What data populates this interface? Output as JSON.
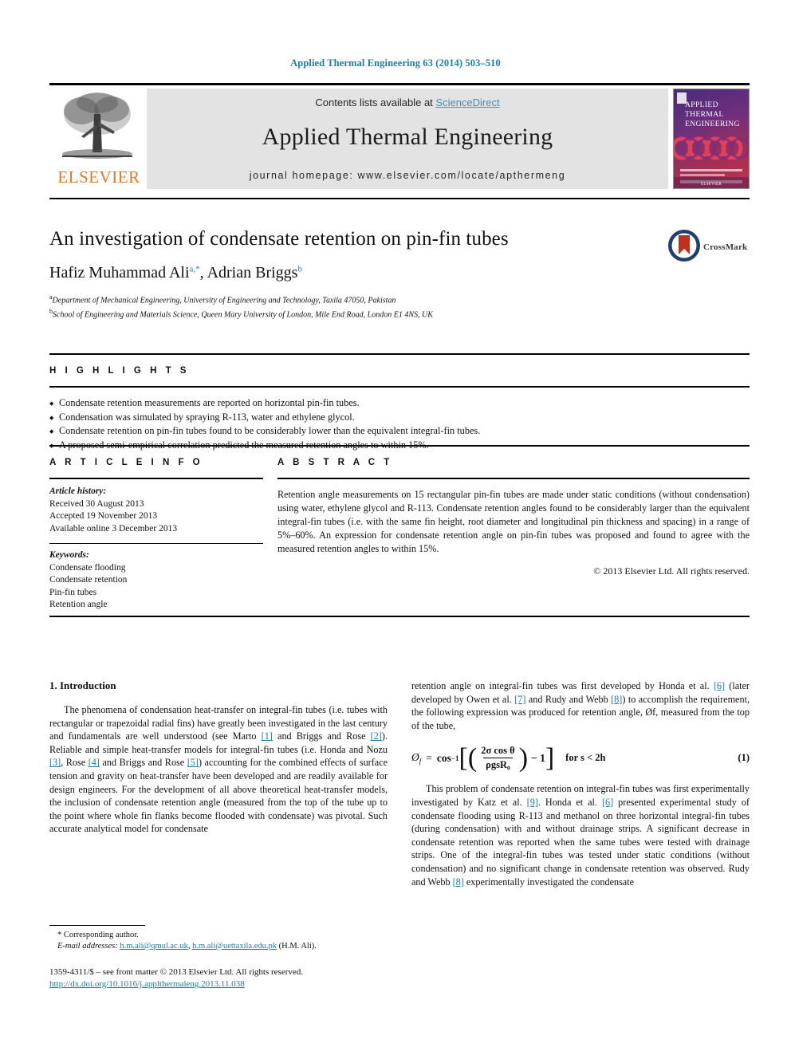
{
  "running_head": "Applied Thermal Engineering 63 (2014) 503–510",
  "masthead": {
    "contents_prefix": "Contents lists available at ",
    "sciencedirect": "ScienceDirect",
    "journal_name": "Applied Thermal Engineering",
    "homepage": "journal homepage: www.elsevier.com/locate/apthermeng",
    "publisher": "ELSEVIER",
    "publisher_logo": "elsevier-tree-logo",
    "cover": {
      "line1": "APPLIED",
      "line2": "THERMAL",
      "line3": "ENGINEERING",
      "footer": "ELSEVIER"
    },
    "accent_blue": "#3d8fc6",
    "band_gray": "#e3e3e3",
    "elsevier_orange": "#e87722"
  },
  "article": {
    "title": "An investigation of condensate retention on pin-fin tubes",
    "authors_html": "Hafiz Muhammad Ali, Adrian Briggs",
    "author1": "Hafiz Muhammad Ali",
    "author1_sup": "a,*",
    "author2": "Adrian Briggs",
    "author2_sup": "b",
    "affiliations": [
      {
        "marker": "a",
        "text": "Department of Mechanical Engineering, University of Engineering and Technology, Taxila 47050, Pakistan"
      },
      {
        "marker": "b",
        "text": "School of Engineering and Materials Science, Queen Mary University of London, Mile End Road, London E1 4NS, UK"
      }
    ],
    "crossmark_label": "CrossMark"
  },
  "highlights": {
    "heading": "H I G H L I G H T S",
    "items": [
      "Condensate retention measurements are reported on horizontal pin-fin tubes.",
      "Condensation was simulated by spraying R-113, water and ethylene glycol.",
      "Condensate retention on pin-fin tubes found to be considerably lower than the equivalent integral-fin tubes.",
      "A proposed semi-empirical correlation predicted the measured retention angles to within 15%."
    ]
  },
  "article_info": {
    "heading": "A R T I C L E    I N F O",
    "history_label": "Article history:",
    "history": [
      "Received 30 August 2013",
      "Accepted 19 November 2013",
      "Available online 3 December 2013"
    ],
    "keywords_label": "Keywords:",
    "keywords": [
      "Condensate flooding",
      "Condensate retention",
      "Pin-fin tubes",
      "Retention angle"
    ]
  },
  "abstract": {
    "heading": "A B S T R A C T",
    "text": "Retention angle measurements on 15 rectangular pin-fin tubes are made under static conditions (without condensation) using water, ethylene glycol and R-113. Condensate retention angles found to be considerably larger than the equivalent integral-fin tubes (i.e. with the same fin height, root diameter and longitudinal pin thickness and spacing) in a range of 5%–60%. An expression for condensate retention angle on pin-fin tubes was proposed and found to agree with the measured retention angles to within 15%.",
    "copyright": "© 2013 Elsevier Ltd. All rights reserved."
  },
  "introduction": {
    "heading": "1.  Introduction",
    "left_paragraph_parts": [
      "The phenomena of condensation heat-transfer on integral-fin tubes (i.e. tubes with rectangular or trapezoidal radial fins) have greatly been investigated in the last century and fundamentals are well understood (see Marto ",
      "[1]",
      " and Briggs and Rose ",
      "[2]",
      "). Reliable and simple heat-transfer models for integral-fin tubes (i.e. Honda and Nozu ",
      "[3]",
      ", Rose ",
      "[4]",
      " and Briggs and Rose ",
      "[5]",
      ") accounting for the combined effects of surface tension and gravity on heat-transfer have been developed and are readily available for design engineers. For the development of all above theoretical heat-transfer models, the inclusion of condensate retention angle (measured from the top of the tube up to the point where whole fin flanks become flooded with condensate) was pivotal. Such accurate analytical model for condensate"
    ],
    "right_paragraph1_parts": [
      "retention angle on integral-fin tubes was first developed by Honda et al. ",
      "[6]",
      " (later developed by Owen et al. ",
      "[7]",
      " and Rudy and Webb ",
      "[8]",
      ") to accomplish the requirement, the following expression was produced for retention angle, Øf, measured from the top of the tube,"
    ],
    "right_paragraph2_parts": [
      "This problem of condensate retention on integral-fin tubes was first experimentally investigated by Katz et al. ",
      "[9]",
      ". Honda et al. ",
      "[6]",
      " presented experimental study of condensate flooding using R-113 and methanol on three horizontal integral-fin tubes (during condensation) with and without drainage strips. A significant decrease in condensate retention was reported when the same tubes were tested with drainage strips. One of the integral-fin tubes was tested under static conditions (without condensation) and no significant change in condensate retention was observed. Rudy and Webb ",
      "[8]",
      " experimentally investigated the condensate"
    ]
  },
  "equation": {
    "lhs": "Ø",
    "lhs_sub": "f",
    "equals": "=",
    "func": "cos",
    "exp": "−1",
    "numerator": "2σ cos θ",
    "denominator": "ρgsR₀",
    "minus_one": "− 1",
    "condition": "for  s < 2h",
    "number": "(1)"
  },
  "footnotes": {
    "corresponding": "* Corresponding author.",
    "email_label": "E-mail addresses:",
    "email1": "h.m.ali@qmul.ac.uk",
    "email2": "h.m.ali@uettaxila.edu.pk",
    "email_suffix": "(H.M. Ali)."
  },
  "page_footer": {
    "issn_line": "1359-4311/$ – see front matter © 2013 Elsevier Ltd. All rights reserved.",
    "doi": "http://dx.doi.org/10.1016/j.applthermaleng.2013.11.038"
  }
}
